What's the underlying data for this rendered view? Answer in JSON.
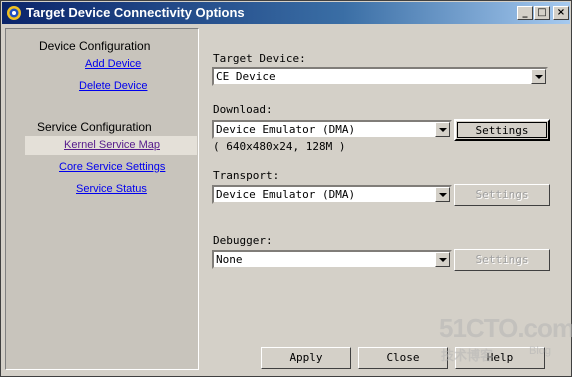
{
  "window": {
    "title": "Target Device Connectivity Options"
  },
  "sidebar": {
    "device_heading": "Device Configuration",
    "add_device": "Add Device",
    "delete_device": "Delete Device",
    "service_heading": "Service Configuration",
    "kernel_service_map": "Kernel Service Map",
    "core_service_settings": "Core Service Settings",
    "service_status": "Service Status"
  },
  "target_device": {
    "label": "Target Device:",
    "value": "CE Device"
  },
  "download": {
    "label": "Download:",
    "value": "Device Emulator (DMA)",
    "settings": "Settings",
    "info": "( 640x480x24, 128M )"
  },
  "transport": {
    "label": "Transport:",
    "value": "Device Emulator (DMA)",
    "settings": "Settings"
  },
  "debugger": {
    "label": "Debugger:",
    "value": "None",
    "settings": "Settings"
  },
  "footer": {
    "apply": "Apply",
    "close": "Close",
    "help": "Help"
  },
  "watermark": {
    "main": "51CTO.com",
    "sub": "技术博客",
    "blog": "Blog"
  },
  "colors": {
    "titlebar_start": "#0a246a",
    "titlebar_end": "#a6caf0",
    "link": "#0000ee",
    "visited_link": "#551a8b"
  }
}
